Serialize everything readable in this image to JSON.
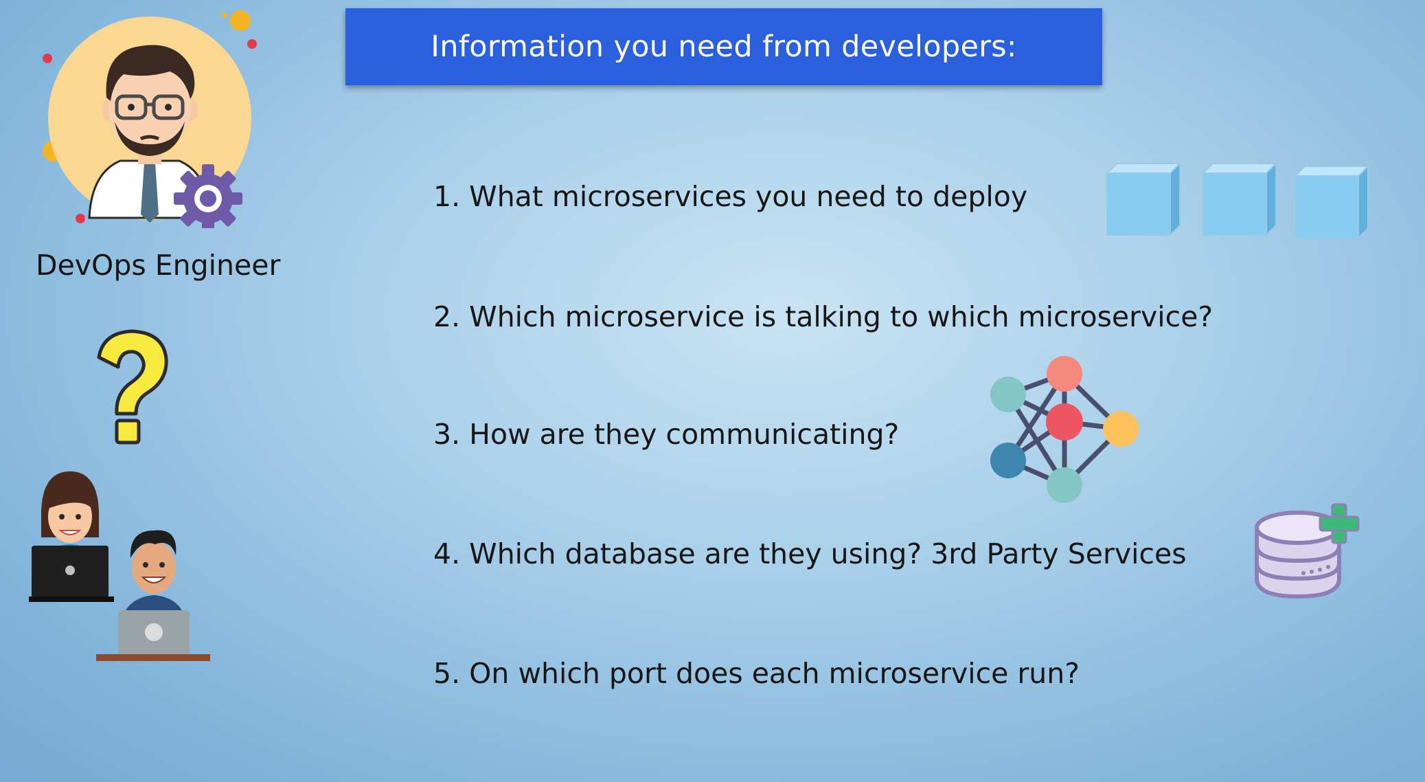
{
  "slide": {
    "title": "Information you need from developers:",
    "role_label": "DevOps Engineer",
    "questions": [
      {
        "text": "1. What microservices you need to deploy"
      },
      {
        "text": "2. Which microservice is talking to which microservice?"
      },
      {
        "text": "3. How are they communicating?"
      },
      {
        "text": "4. Which database are they using? 3rd Party Services"
      },
      {
        "text": "5. On which port does each microservice run?"
      }
    ]
  },
  "colors": {
    "banner": "#2a5fdd",
    "text": "#161616",
    "cube": "#7cc8ef",
    "db_outline": "#8e7fb6",
    "plus": "#3fb97a"
  },
  "icons": {
    "engineer": "engineer-avatar-icon",
    "gear": "gear-icon",
    "question": "question-mark-icon",
    "developers": "developers-with-laptops-icon",
    "cubes": "microservice-cube-icon",
    "network": "network-graph-icon",
    "database": "database-add-icon"
  }
}
